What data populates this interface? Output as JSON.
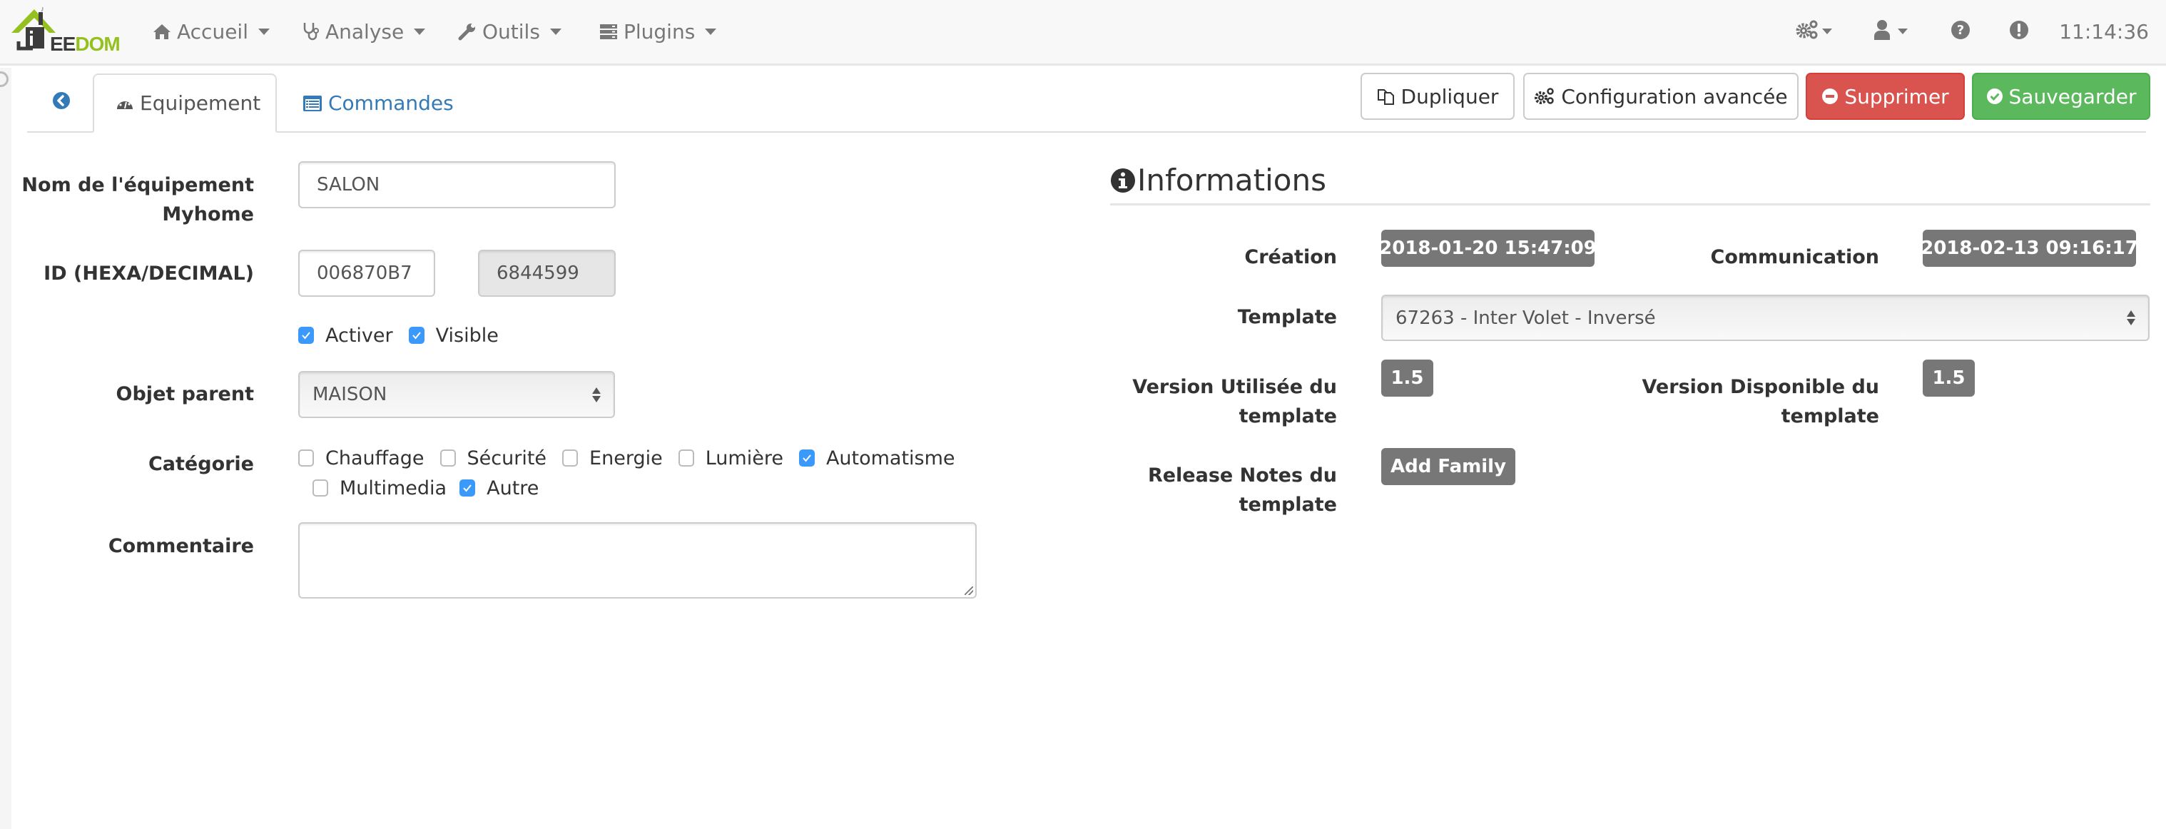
{
  "navbar": {
    "logo": {
      "left_text": "EE",
      "right_text": "DOM",
      "accent_color": "#94c11f",
      "dark_color": "#3c3c3c"
    },
    "menus": [
      {
        "label": "Accueil",
        "icon": "home-icon"
      },
      {
        "label": "Analyse",
        "icon": "stethoscope-icon"
      },
      {
        "label": "Outils",
        "icon": "wrench-icon"
      },
      {
        "label": "Plugins",
        "icon": "server-icon"
      }
    ],
    "right_icons": [
      "cogs-icon",
      "user-icon",
      "question-circle-icon",
      "exclamation-circle-icon"
    ],
    "clock": "11:14:36"
  },
  "tabs": {
    "back_icon": "arrow-circle-left-icon",
    "items": [
      {
        "label": "Equipement",
        "icon": "tachometer-icon",
        "active": true
      },
      {
        "label": "Commandes",
        "icon": "list-alt-icon",
        "active": false
      }
    ]
  },
  "toolbar": {
    "duplicate_label": "Dupliquer",
    "advanced_config_label": "Configuration avancée",
    "delete_label": "Supprimer",
    "save_label": "Sauvegarder",
    "colors": {
      "danger": "#d9534f",
      "success": "#5cb85c",
      "link": "#337ab7"
    }
  },
  "form": {
    "name_label_line1": "Nom de l'équipement",
    "name_label_line2": "Myhome",
    "name_value": "SALON",
    "id_label": "ID (HEXA/DECIMAL)",
    "id_hex_value": "006870B7",
    "id_decimal_value": "6844599",
    "enable_label": "Activer",
    "enable_checked": true,
    "visible_label": "Visible",
    "visible_checked": true,
    "parent_label": "Objet parent",
    "parent_value": "MAISON",
    "category_label": "Catégorie",
    "categories": [
      {
        "label": "Chauffage",
        "checked": false
      },
      {
        "label": "Sécurité",
        "checked": false
      },
      {
        "label": "Energie",
        "checked": false
      },
      {
        "label": "Lumière",
        "checked": false
      },
      {
        "label": "Automatisme",
        "checked": true
      },
      {
        "label": "Multimedia",
        "checked": false
      },
      {
        "label": "Autre",
        "checked": true
      }
    ],
    "comment_label": "Commentaire",
    "comment_value": ""
  },
  "info": {
    "title": "Informations",
    "creation_label": "Création",
    "creation_value": "2018-01-20 15:47:09",
    "communication_label": "Communication",
    "communication_value": "2018-02-13 09:16:17",
    "template_label": "Template",
    "template_value": "67263 - Inter Volet - Inversé",
    "version_used_label_line1": "Version Utilisée du",
    "version_used_label_line2": "template",
    "version_used_value": "1.5",
    "version_available_label": "Version Disponible du template",
    "version_available_value": "1.5",
    "release_notes_label_line1": "Release Notes du",
    "release_notes_label_line2": "template",
    "release_notes_value": "Add Family"
  }
}
